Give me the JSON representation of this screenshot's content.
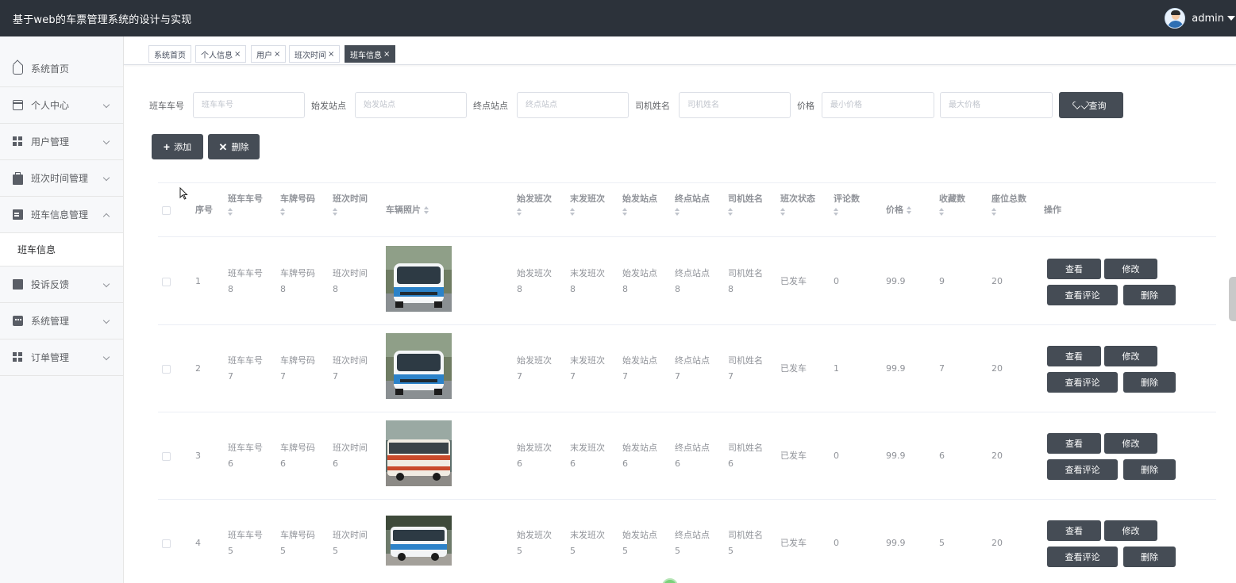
{
  "app": {
    "title": "基于web的车票管理系统的设计与实现",
    "username": "admin"
  },
  "sidebar": {
    "items": [
      {
        "label": "系统首页",
        "icon": "home-icon"
      },
      {
        "label": "个人中心",
        "icon": "card-icon"
      },
      {
        "label": "用户管理",
        "icon": "grid-icon"
      },
      {
        "label": "班次时间管理",
        "icon": "briefcase-icon"
      },
      {
        "label": "班车信息管理",
        "icon": "document-icon",
        "expanded": true
      },
      {
        "label": "投诉反馈",
        "icon": "monitor-icon"
      },
      {
        "label": "系统管理",
        "icon": "chat-icon"
      },
      {
        "label": "订单管理",
        "icon": "grid-icon"
      }
    ],
    "submenu": {
      "label": "班车信息"
    }
  },
  "tabs": [
    {
      "label": "系统首页",
      "closable": false
    },
    {
      "label": "个人信息",
      "closable": true
    },
    {
      "label": "用户",
      "closable": true
    },
    {
      "label": "班次时间",
      "closable": true
    },
    {
      "label": "班车信息",
      "closable": true,
      "active": true
    }
  ],
  "tab_close": "×",
  "search": {
    "fields": [
      {
        "label": "班车车号",
        "placeholder": "班车车号"
      },
      {
        "label": "始发站点",
        "placeholder": "始发站点"
      },
      {
        "label": "终点站点",
        "placeholder": "终点站点"
      },
      {
        "label": "司机姓名",
        "placeholder": "司机姓名"
      },
      {
        "label": "价格",
        "placeholder": "最小价格"
      },
      {
        "label": "",
        "placeholder": "最大价格"
      }
    ],
    "query_button": "查询"
  },
  "toolbar": {
    "add_label": "添加",
    "delete_label": "删除"
  },
  "table": {
    "headers": {
      "index": "序号",
      "bus_no": "班车车号",
      "plate": "车牌号码",
      "schedule_time": "班次时间",
      "photo": "车辆照片",
      "first_shift": "始发班次",
      "last_shift": "末发班次",
      "start_station": "始发站点",
      "end_station": "终点站点",
      "driver": "司机姓名",
      "status": "班次状态",
      "comments": "评论数",
      "price": "价格",
      "favorites": "收藏数",
      "seats": "座位总数",
      "ops": "操作"
    },
    "rows": [
      {
        "index": "1",
        "bus_no": [
          "班车车号",
          "8"
        ],
        "plate": [
          "车牌号码",
          "8"
        ],
        "schedule_time": [
          "班次时间",
          "8"
        ],
        "photo": "bus-front-blue",
        "first_shift": [
          "始发班次",
          "8"
        ],
        "last_shift": [
          "末发班次",
          "8"
        ],
        "start_station": [
          "始发站点",
          "8"
        ],
        "end_station": [
          "终点站点",
          "8"
        ],
        "driver": [
          "司机姓名",
          "8"
        ],
        "status": "已发车",
        "comments": "0",
        "price": "99.9",
        "favorites": "9",
        "seats": "20"
      },
      {
        "index": "2",
        "bus_no": [
          "班车车号",
          "7"
        ],
        "plate": [
          "车牌号码",
          "7"
        ],
        "schedule_time": [
          "班次时间",
          "7"
        ],
        "photo": "bus-front-blue",
        "first_shift": [
          "始发班次",
          "7"
        ],
        "last_shift": [
          "末发班次",
          "7"
        ],
        "start_station": [
          "始发站点",
          "7"
        ],
        "end_station": [
          "终点站点",
          "7"
        ],
        "driver": [
          "司机姓名",
          "7"
        ],
        "status": "已发车",
        "comments": "1",
        "price": "99.9",
        "favorites": "7",
        "seats": "20"
      },
      {
        "index": "3",
        "bus_no": [
          "班车车号",
          "6"
        ],
        "plate": [
          "车牌号码",
          "6"
        ],
        "schedule_time": [
          "班次时间",
          "6"
        ],
        "photo": "bus-side-red",
        "first_shift": [
          "始发班次",
          "6"
        ],
        "last_shift": [
          "末发班次",
          "6"
        ],
        "start_station": [
          "始发站点",
          "6"
        ],
        "end_station": [
          "终点站点",
          "6"
        ],
        "driver": [
          "司机姓名",
          "6"
        ],
        "status": "已发车",
        "comments": "0",
        "price": "99.9",
        "favorites": "6",
        "seats": "20"
      },
      {
        "index": "4",
        "bus_no": [
          "班车车号",
          "5"
        ],
        "plate": [
          "车牌号码",
          "5"
        ],
        "schedule_time": [
          "班次时间",
          "5"
        ],
        "photo": "bus-side-blue",
        "first_shift": [
          "始发班次",
          "5"
        ],
        "last_shift": [
          "末发班次",
          "5"
        ],
        "start_station": [
          "始发站点",
          "5"
        ],
        "end_station": [
          "终点站点",
          "5"
        ],
        "driver": [
          "司机姓名",
          "5"
        ],
        "status": "已发车",
        "comments": "0",
        "price": "99.9",
        "favorites": "5",
        "seats": "20"
      }
    ],
    "actions": {
      "view": "查看",
      "edit": "修改",
      "view_comments": "查看评论",
      "delete": "删除"
    }
  },
  "colors": {
    "header_bg": "#2c323a",
    "button_dark": "#454c55",
    "sidebar_bg": "#f7f8fa"
  }
}
